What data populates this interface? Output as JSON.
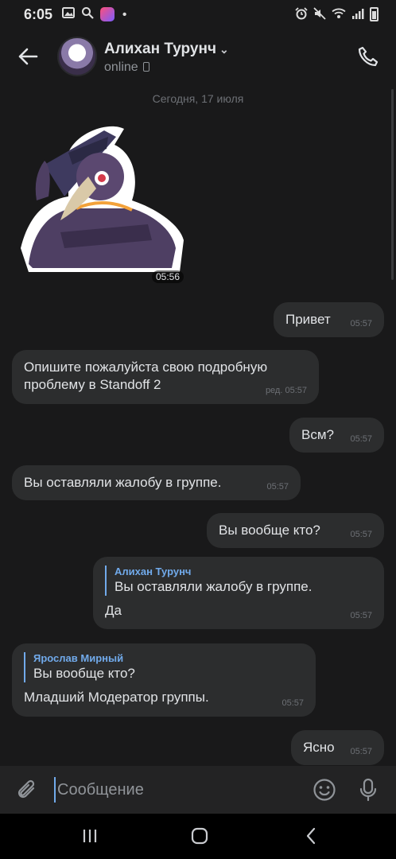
{
  "status_bar": {
    "time": "6:05",
    "left_icons": [
      "gallery-icon",
      "search-icon",
      "vk-app-icon",
      "dot-icon"
    ],
    "right_icons": [
      "alarm-icon",
      "mute-icon",
      "wifi-icon",
      "signal-icon",
      "battery-icon"
    ]
  },
  "header": {
    "name": "Алихан Турунч",
    "status": "online",
    "status_device_icon": "mobile-icon"
  },
  "date_separator": "Сегодня, 17 июля",
  "sticker": {
    "icon": "plague-doctor-sticker",
    "time": "05:56"
  },
  "messages": [
    {
      "side": "out",
      "text": "Привет",
      "time": "05:57"
    },
    {
      "side": "in",
      "text": "Опишите пожалуйста свою подробную проблему в Standoff 2",
      "time": "ред. 05:57"
    },
    {
      "side": "out",
      "text": "Всм?",
      "time": "05:57"
    },
    {
      "side": "in",
      "text": "Вы оставляли жалобу в группе.",
      "time": "05:57"
    },
    {
      "side": "out",
      "text": "Вы вообще кто?",
      "time": "05:57"
    },
    {
      "side": "out",
      "reply_name": "Алихан Турунч",
      "reply_text": "Вы оставляли жалобу в группе.",
      "text": "Да",
      "time": "05:57"
    },
    {
      "side": "in",
      "reply_name": "Ярослав Мирный",
      "reply_text": "Вы вообще кто?",
      "text": "Младший Модератор группы.",
      "time": "05:57"
    },
    {
      "side": "out",
      "text": "Ясно",
      "time": "05:57"
    }
  ],
  "composer": {
    "placeholder": "Сообщение"
  },
  "colors": {
    "background": "#19191a",
    "bubble": "#2c2d2e",
    "accent": "#71aaeb",
    "secondary_text": "#909499"
  }
}
